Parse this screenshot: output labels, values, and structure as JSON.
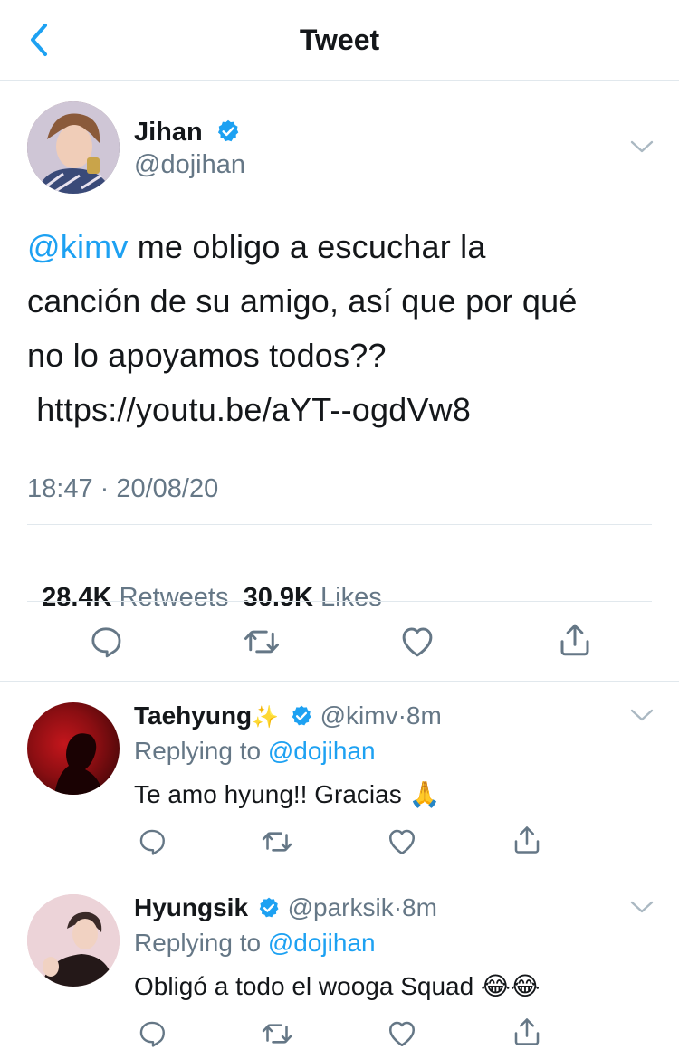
{
  "header": {
    "title": "Tweet"
  },
  "tweet": {
    "author_name": "Jihan",
    "author_handle": "@dojihan",
    "mention": "@kimv",
    "text_line1_rest": " me obligo a escuchar la",
    "text_line2": "canción de su amigo, así que por qué",
    "text_line3": "no lo apoyamos todos??",
    "link": " https://youtu.be/aYT--ogdVw8",
    "time": "18:47",
    "separator": " · ",
    "date": "20/08/20",
    "retweets_count": "28.4K",
    "retweets_label": "Retweets",
    "likes_count": "30.9K",
    "likes_label": "Likes"
  },
  "replies": [
    {
      "name": "Taehyung",
      "sparkle": "✨",
      "handle": "@kimv",
      "dot": "·",
      "time": "8m",
      "replying_label": "Replying to",
      "replying_handle": "@dojihan",
      "text": "Te amo hyung!! Gracias",
      "emoji": "🙏"
    },
    {
      "name": "Hyungsik",
      "handle": "@parksik",
      "dot": "·",
      "time": "8m",
      "replying_label": "Replying to",
      "replying_handle": "@dojihan",
      "text": "Obligó a todo el wooga Squad",
      "emoji": "😂😂"
    }
  ],
  "colors": {
    "accent": "#1da1f2",
    "text": "#14171a",
    "secondary": "#657786",
    "divider": "#e1e8ed"
  }
}
